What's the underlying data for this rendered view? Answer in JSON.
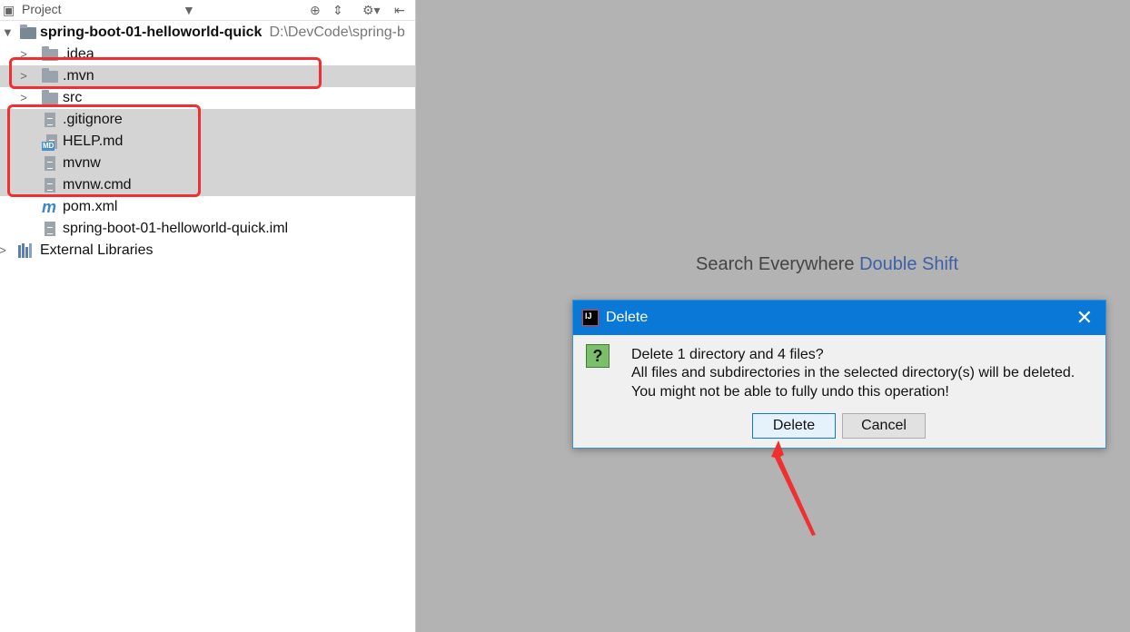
{
  "panel": {
    "title": "Project"
  },
  "tree": {
    "root": {
      "label": "spring-boot-01-helloworld-quick",
      "path": "D:\\DevCode\\spring-b"
    },
    "items": [
      {
        "label": ".idea",
        "icon": "folder-icon"
      },
      {
        "label": ".mvn",
        "icon": "folder-icon"
      },
      {
        "label": "src",
        "icon": "folder-icon"
      },
      {
        "label": ".gitignore",
        "icon": "file-icon"
      },
      {
        "label": "HELP.md",
        "icon": "markdown-file-icon",
        "badge": "MD"
      },
      {
        "label": "mvnw",
        "icon": "file-icon"
      },
      {
        "label": "mvnw.cmd",
        "icon": "file-icon"
      },
      {
        "label": "pom.xml",
        "icon": "maven-icon",
        "glyph": "m"
      },
      {
        "label": "spring-boot-01-helloworld-quick.iml",
        "icon": "module-file-icon"
      }
    ],
    "libraries": {
      "label": "External Libraries"
    }
  },
  "editor": {
    "hint_text": "Search Everywhere",
    "hint_key": "Double Shift"
  },
  "dialog": {
    "title": "Delete",
    "message_lines": [
      "Delete 1 directory and 4 files?",
      "All files and subdirectories in the selected directory(s) will be deleted.",
      "You might not be able to fully undo this operation!"
    ],
    "delete_label": "Delete",
    "cancel_label": "Cancel",
    "question_glyph": "?"
  },
  "colors": {
    "annotation_red": "#f03030",
    "dialog_title_bar": "#0a78d7",
    "selection": "#d4d4d4"
  }
}
